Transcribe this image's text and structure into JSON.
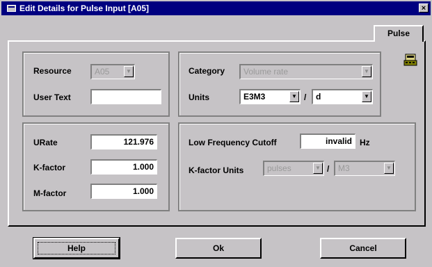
{
  "window": {
    "title": "Edit Details for Pulse Input [A05]",
    "close": "×"
  },
  "tab": {
    "label": "Pulse"
  },
  "resource_group": {
    "resource_label": "Resource",
    "resource_value": "A05",
    "user_text_label": "User Text",
    "user_text_value": ""
  },
  "category_group": {
    "category_label": "Category",
    "category_value": "Volume rate",
    "units_label": "Units",
    "units_value": "E3M3",
    "units_sep": "/",
    "units_time": "d"
  },
  "factors_group": {
    "urate_label": "URate",
    "urate_value": "121.976",
    "kfactor_label": "K-factor",
    "kfactor_value": "1.000",
    "mfactor_label": "M-factor",
    "mfactor_value": "1.000"
  },
  "cutoff_group": {
    "lfc_label": "Low Frequency Cutoff",
    "lfc_value": "invalid",
    "lfc_unit": "Hz",
    "kunits_label": "K-factor Units",
    "kunits_value": "pulses",
    "kunits_sep": "/",
    "kunits_volume": "M3"
  },
  "buttons": {
    "help": "Help",
    "ok": "Ok",
    "cancel": "Cancel"
  },
  "icons": {
    "dropdown_arrow": "▼"
  }
}
